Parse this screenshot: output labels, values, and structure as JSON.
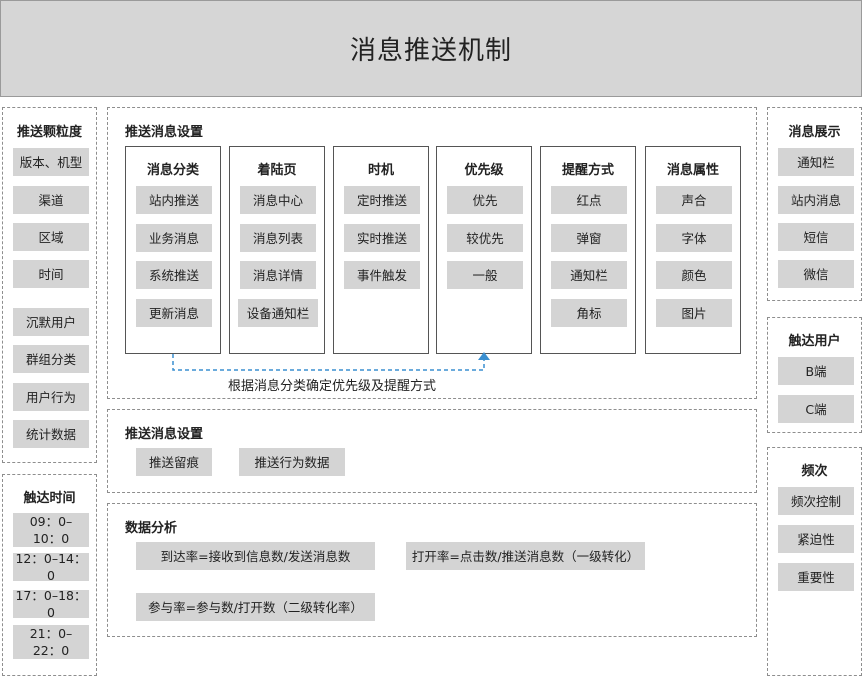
{
  "title": "消息推送机制",
  "left": {
    "granularity": {
      "title": "推送颗粒度",
      "items": [
        "版本、机型",
        "渠道",
        "区域",
        "时间",
        "沉默用户",
        "群组分类",
        "用户行为",
        "统计数据"
      ]
    },
    "reach_time": {
      "title": "触达时间",
      "items": [
        "09：0–10：0",
        "12：0–14：0",
        "17：0–18：0",
        "21：0–22：0"
      ]
    }
  },
  "center": {
    "settings": {
      "title": "推送消息设置",
      "columns": [
        {
          "title": "消息分类",
          "items": [
            "站内推送",
            "业务消息",
            "系统推送",
            "更新消息"
          ]
        },
        {
          "title": "着陆页",
          "items": [
            "消息中心",
            "消息列表",
            "消息详情",
            "设备通知栏"
          ]
        },
        {
          "title": "时机",
          "items": [
            "定时推送",
            "实时推送",
            "事件触发"
          ]
        },
        {
          "title": "优先级",
          "items": [
            "优先",
            "较优先",
            "一般"
          ]
        },
        {
          "title": "提醒方式",
          "items": [
            "红点",
            "弹窗",
            "通知栏",
            "角标"
          ]
        },
        {
          "title": "消息属性",
          "items": [
            "声合",
            "字体",
            "颜色",
            "图片"
          ]
        }
      ],
      "note": "根据消息分类确定优先级及提醒方式"
    },
    "settings2": {
      "title": "推送消息设置",
      "items": [
        "推送留痕",
        "推送行为数据"
      ]
    },
    "analysis": {
      "title": "数据分析",
      "items": [
        "到达率=接收到信息数/发送消息数",
        "打开率=点击数/推送消息数（一级转化）",
        "参与率=参与数/打开数（二级转化率）"
      ]
    }
  },
  "right": {
    "display": {
      "title": "消息展示",
      "items": [
        "通知栏",
        "站内消息",
        "短信",
        "微信"
      ]
    },
    "reach_users": {
      "title": "触达用户",
      "items": [
        "B端",
        "C端"
      ]
    },
    "frequency": {
      "title": "频次",
      "items": [
        "频次控制",
        "紧迫性",
        "重要性"
      ]
    }
  },
  "colors": {
    "header_bg": "#d6d6d6",
    "chip_bg": "#d4d4d4",
    "arrow": "#3a8fd0"
  }
}
